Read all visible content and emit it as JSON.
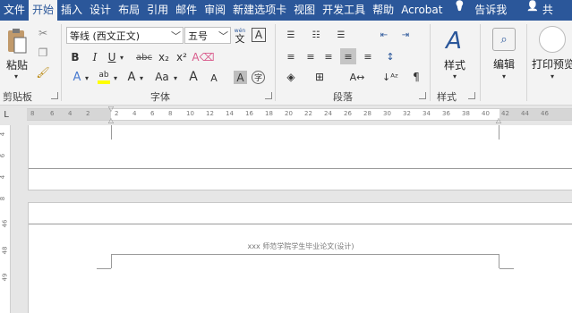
{
  "tabs": [
    {
      "label": "文件",
      "active": false
    },
    {
      "label": "开始",
      "active": true
    },
    {
      "label": "插入",
      "active": false
    },
    {
      "label": "设计",
      "active": false
    },
    {
      "label": "布局",
      "active": false
    },
    {
      "label": "引用",
      "active": false
    },
    {
      "label": "邮件",
      "active": false
    },
    {
      "label": "审阅",
      "active": false
    },
    {
      "label": "新建选项卡",
      "active": false
    },
    {
      "label": "视图",
      "active": false
    },
    {
      "label": "开发工具",
      "active": false
    },
    {
      "label": "帮助",
      "active": false
    },
    {
      "label": "Acrobat",
      "active": false
    },
    {
      "label": "告诉我",
      "active": false
    },
    {
      "label": "共",
      "active": false
    }
  ],
  "ribbon": {
    "clipboard": {
      "paste_label": "粘贴",
      "group_label": "剪贴板"
    },
    "font": {
      "font_name": "等线 (西文正文)",
      "font_size": "五号",
      "wen_label": "wén",
      "wen_char": "文",
      "box_a": "A",
      "bold": "B",
      "italic": "I",
      "underline": "U",
      "strike": "abc",
      "sub": "x₂",
      "sup": "x²",
      "aa": "Aa",
      "a_grow": "A",
      "a_shrink": "A",
      "char_shade": "A",
      "circle_char": "字",
      "group_label": "字体"
    },
    "paragraph": {
      "group_label": "段落"
    },
    "styles": {
      "styles_label": "样式",
      "group_label": "样式"
    },
    "editing": {
      "label": "编辑"
    },
    "print_preview": {
      "label": "打印预览"
    }
  },
  "ruler": {
    "ticks": [
      "8",
      "6",
      "4",
      "2",
      "2",
      "4",
      "6",
      "8",
      "10",
      "12",
      "14",
      "16",
      "18",
      "20",
      "22",
      "24",
      "26",
      "28",
      "30",
      "32",
      "34",
      "36",
      "38",
      "40",
      "42",
      "44",
      "46"
    ],
    "vticks": [
      "4",
      "6",
      "4",
      "8",
      "46",
      "48",
      "49"
    ]
  },
  "document": {
    "header_text": "xxx 师范学院学生毕业论文(设计)"
  },
  "colors": {
    "accent": "#2b579a",
    "ribbon_bg": "#f3f3f3",
    "highlight": "#ffff00",
    "font_red": "#c00000"
  }
}
